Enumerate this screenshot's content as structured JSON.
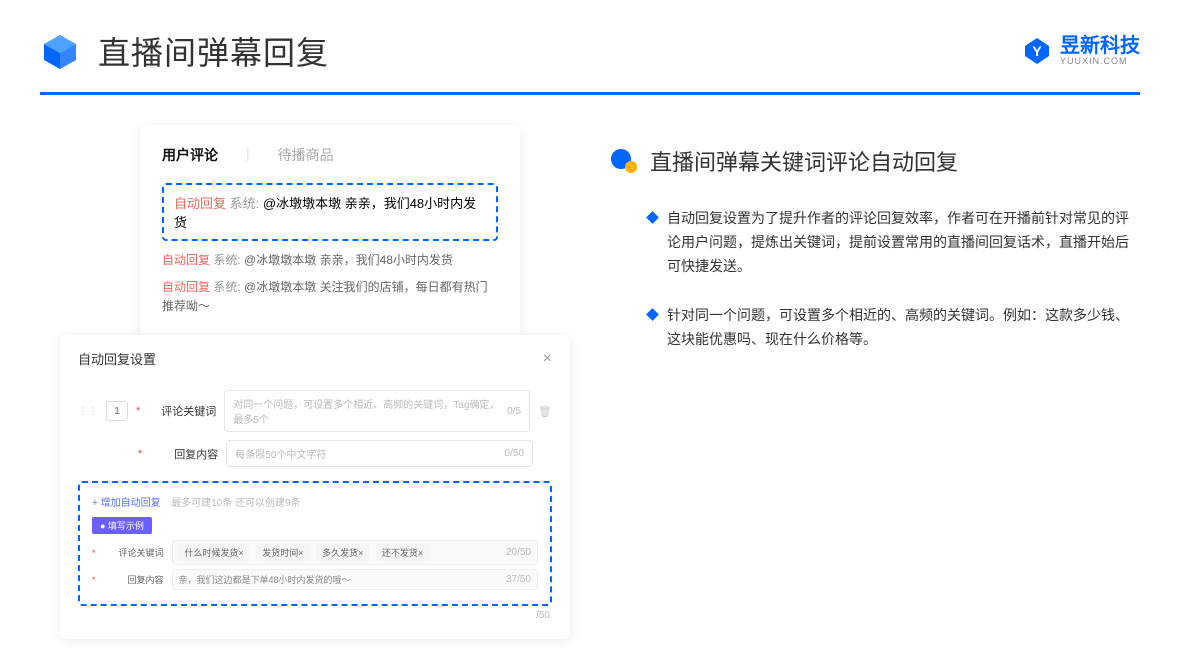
{
  "header": {
    "title": "直播间弹幕回复",
    "brand_name": "昱新科技",
    "brand_sub": "YUUXIN.COM"
  },
  "comments_card": {
    "tab_active": "用户评论",
    "tab_inactive": "待播商品",
    "highlighted": {
      "tag": "自动回复",
      "sys": "系统:",
      "text": "@冰墩墩本墩 亲亲，我们48小时内发货"
    },
    "line2": {
      "tag": "自动回复",
      "sys": "系统:",
      "text": "@冰墩墩本墩 亲亲，我们48小时内发货"
    },
    "line3": {
      "tag": "自动回复",
      "sys": "系统:",
      "text": "@冰墩墩本墩 关注我们的店铺，每日都有热门推荐呦～"
    }
  },
  "settings_card": {
    "title": "自动回复设置",
    "close": "×",
    "number": "1",
    "row1_label": "评论关键词",
    "row1_placeholder": "对同一个问题，可设置多个相近、高频的关键词，Tag确定，最多5个",
    "row1_count": "0/5",
    "row2_label": "回复内容",
    "row2_placeholder": "每条限50个中文字符",
    "row2_count": "0/50",
    "add_link": "+ 增加自动回复",
    "add_note": "最多可建10条 还可以创建9条",
    "example_badge": "● 填写示例",
    "ex_kw_label": "评论关键词",
    "ex_kw_tags": [
      "什么时候发货×",
      "发货时间×",
      "多久发货×",
      "还不发货×"
    ],
    "ex_kw_count": "20/50",
    "ex_reply_label": "回复内容",
    "ex_reply_text": "亲，我们这边都是下单48小时内发货的哦～",
    "ex_reply_count": "37/50",
    "outer_count": "/50"
  },
  "right": {
    "section_title": "直播间弹幕关键词评论自动回复",
    "bullet1": "自动回复设置为了提升作者的评论回复效率，作者可在开播前针对常见的评论用户问题，提炼出关键词，提前设置常用的直播间回复话术，直播开始后可快捷发送。",
    "bullet2": "针对同一个问题，可设置多个相近的、高频的关键词。例如：这款多少钱、这块能优惠吗、现在什么价格等。"
  }
}
